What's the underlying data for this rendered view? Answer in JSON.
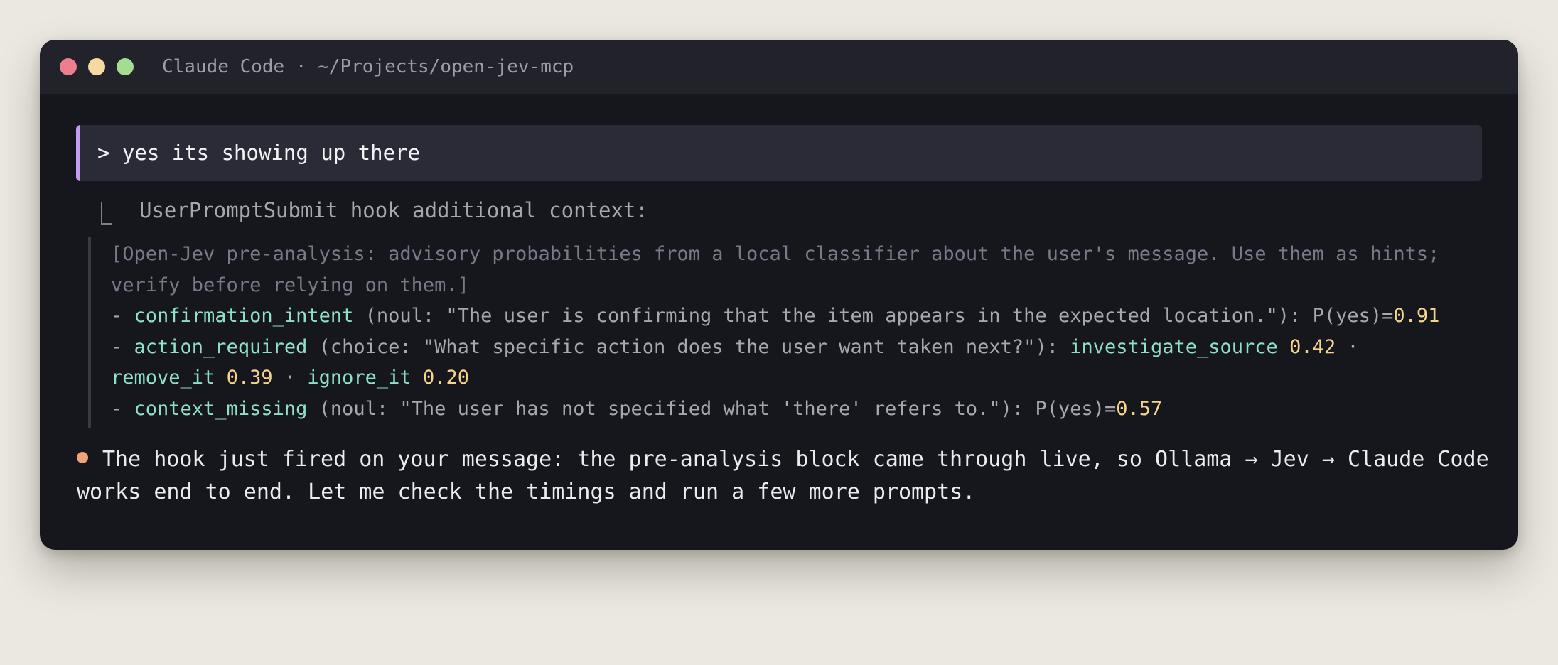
{
  "window": {
    "title": "Claude Code · ~/Projects/open-jev-mcp",
    "colors": {
      "close": "#ec7e8d",
      "minimize": "#f5d9a1",
      "maximize": "#a4dc91",
      "accent": "#c59cf4",
      "key": "#8fe0c8",
      "number": "#f5d48c",
      "bullet": "#f0a27a"
    }
  },
  "prompt": {
    "text": "> yes its showing up there"
  },
  "hook": {
    "label": "UserPromptSubmit hook additional context:",
    "intro_lines": [
      "[Open-Jev pre-analysis: advisory probabilities from a local classifier about the user's message. Use them as hints;",
      "verify before relying on them.]"
    ],
    "items": [
      {
        "dash": "- ",
        "name": "confirmation_intent",
        "desc": " (noul: \"The user is confirming that the item appears in the expected location.\"): P(yes)=",
        "prob": "0.91"
      },
      {
        "dash": "- ",
        "name": "action_required",
        "desc": " (choice: \"What specific action does the user want taken next?\"): ",
        "options": [
          {
            "name": "investigate_source",
            "prob": "0.42"
          },
          {
            "name": "remove_it",
            "prob": "0.39"
          },
          {
            "name": "ignore_it",
            "prob": "0.20"
          }
        ],
        "separator": " · "
      },
      {
        "dash": "- ",
        "name": "context_missing",
        "desc": " (noul: \"The user has not specified what 'there' refers to.\"): P(yes)=",
        "prob": "0.57"
      }
    ]
  },
  "response": {
    "lines": [
      "The hook just fired on your message: the pre-analysis block came through live, so Ollama → Jev → Claude Code",
      "works end to end. Let me check the timings and run a few more prompts."
    ]
  }
}
